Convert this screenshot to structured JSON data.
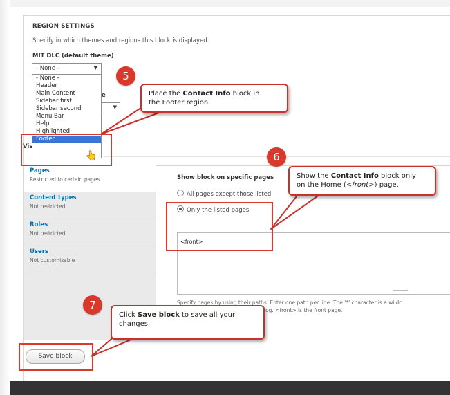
{
  "region_settings": {
    "title": "REGION SETTINGS",
    "description": "Specify in which themes and regions this block is displayed.",
    "theme_label": "MIT DLC (default theme)",
    "region_select": {
      "value": "- None -",
      "arrow": "▼"
    },
    "region_options": [
      "- None -",
      "Header",
      "Main Content",
      "Sidebar first",
      "Sidebar second",
      "Menu Bar",
      "Help",
      "Highlighted",
      "Footer"
    ],
    "highlighted_option": "Footer",
    "hidden_label_fragment": "e",
    "hidden_select_arrow": "▼",
    "hidden_vis_fragment": "Vis"
  },
  "visibility_tabs": [
    {
      "title": "Pages",
      "summary": "Restricted to certain pages"
    },
    {
      "title": "Content types",
      "summary": "Not restricted"
    },
    {
      "title": "Roles",
      "summary": "Not restricted"
    },
    {
      "title": "Users",
      "summary": "Not customizable"
    }
  ],
  "pages_pane": {
    "heading": "Show block on specific pages",
    "options": [
      "All pages except those listed",
      "Only the listed pages"
    ],
    "selected": "Only the listed pages",
    "textarea_value": "<front>",
    "help_line1": "Specify pages by using their paths. Enter one path per line. The '*' character is a wildc",
    "help_line2": "log. <front> is the front page."
  },
  "save_button": "Save block",
  "callouts": {
    "step5": {
      "number": "5",
      "pre": "Place the ",
      "bold": "Contact Info",
      "post": " block in",
      "line2": "the Footer region."
    },
    "step6": {
      "number": "6",
      "pre": "Show the ",
      "bold": "Contact Info",
      "post": " block only",
      "line2_pre": "on the Home (",
      "line2_em": "<front>",
      "line2_post": ") page."
    },
    "step7": {
      "number": "7",
      "pre": "Click ",
      "bold": "Save block",
      "post": " to save all your",
      "line2": "changes."
    }
  },
  "colors": {
    "annotation_red": "#d9392b",
    "link_blue": "#0071b3",
    "selected_option_bg": "#3875d7",
    "footer_bar": "#333333"
  }
}
